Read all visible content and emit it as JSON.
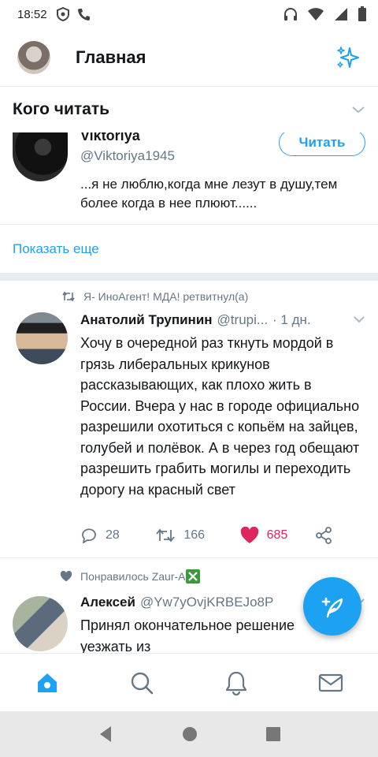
{
  "status": {
    "time": "18:52"
  },
  "header": {
    "title": "Главная"
  },
  "who_to_follow": {
    "title": "Кого читать",
    "user": {
      "name": "Viktoriya",
      "handle": "@Viktoriya1945",
      "follow_label": "Читать",
      "bio": "...я не люблю,когда мне лезут в душу,тем более когда в нее плюют......"
    },
    "show_more": "Показать еще"
  },
  "tweets": [
    {
      "context": "Я- ИноАгент! МДА! ретвитнул(а)",
      "name": "Анатолий Трупинин",
      "handle": "@trupi...",
      "time": "· 1 дн.",
      "text": "Хочу в очередной раз ткнуть мордой в грязь либеральных крикунов рассказывающих, как плохо жить в России. Вчера у нас в городе официально разрешили охотиться с копьём на зайцев, голубей и полёвок. А в через год обещают разрешить грабить могилы и переходить дорогу на красный свет",
      "replies": "28",
      "retweets": "166",
      "likes": "685"
    },
    {
      "context": "Понравилось Zaur-A",
      "name": "Алексей",
      "handle": "@Yw7yOvjKRBEJo8P",
      "text": "Принял окончательное решение уезжать из"
    }
  ],
  "colors": {
    "accent": "#1da1f2",
    "like": "#e0245e",
    "muted": "#657786"
  }
}
